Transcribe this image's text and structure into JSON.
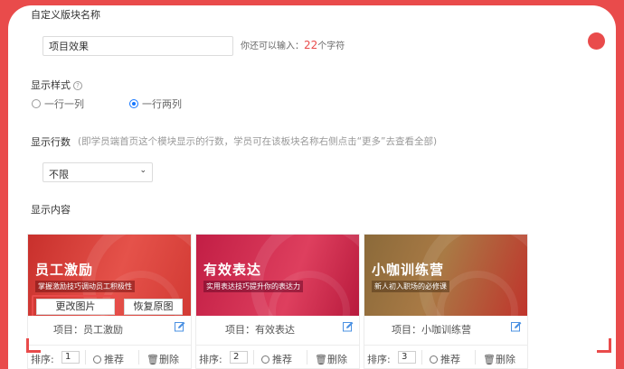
{
  "form": {
    "block_name_label": "自定义版块名称",
    "block_name_value": "项目效果",
    "hint_prefix": "你还可以输入：",
    "hint_count": "22",
    "hint_suffix": "个字符",
    "display_style_label": "显示样式",
    "style_options": [
      "一行一列",
      "一行两列"
    ],
    "selected_style": "一行两列",
    "display_rows_label": "显示行数",
    "display_rows_note": "(即学员端首页这个模块显示的行数，学员可在该板块名称右侧点击“更多”去查看全部)",
    "display_rows_value": "不限",
    "display_content_label": "显示内容"
  },
  "cards": [
    {
      "banner_title": "员工激励",
      "banner_subtitle": "掌握激励技巧调动员工积极性",
      "change_image_label": "更改图片",
      "reset_image_label": "恢复原图",
      "project_text": "项目：员工激励",
      "sort_label": "排序:",
      "sort_value": "1",
      "recommend_label": "推荐",
      "delete_label": "删除"
    },
    {
      "banner_title": "有效表达",
      "banner_subtitle": "实用表达技巧提升你的表达力",
      "project_text": "项目：有效表达",
      "sort_label": "排序:",
      "sort_value": "2",
      "recommend_label": "推荐",
      "delete_label": "删除"
    },
    {
      "banner_title": "小咖训练营",
      "banner_subtitle": "新人初入职场的必修课",
      "project_text": "项目：小咖训练营",
      "sort_label": "排序:",
      "sort_value": "3",
      "recommend_label": "推荐",
      "delete_label": "删除"
    }
  ],
  "colors": {
    "accent": "#e94b4b",
    "radio_selected": "#1677ff",
    "edit_icon": "#4a90e2"
  }
}
